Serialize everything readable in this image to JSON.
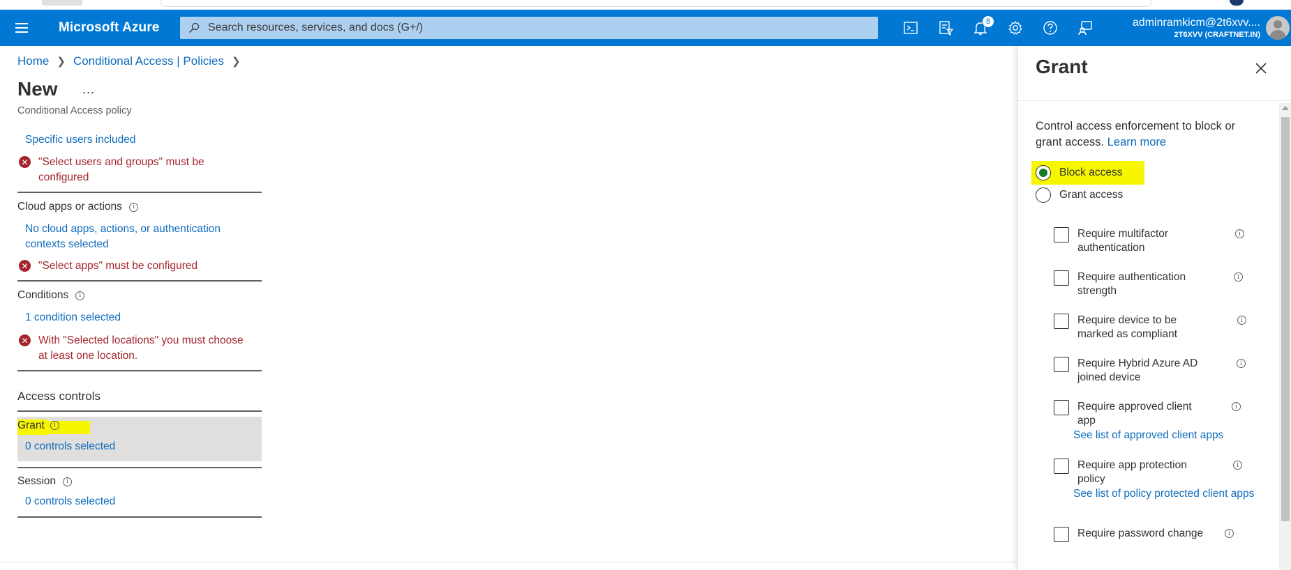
{
  "header": {
    "brand": "Microsoft Azure",
    "search_placeholder": "Search resources, services, and docs (G+/)",
    "notification_count": "8",
    "account_name": "adminramkicm@2t6xvv....",
    "account_tenant": "2T6XVV (CRAFTNET.IN)",
    "icons": [
      "cloud-shell-icon",
      "directory-filter-icon",
      "notifications-icon",
      "settings-icon",
      "help-icon",
      "feedback-icon"
    ]
  },
  "breadcrumb": {
    "home": "Home",
    "policies": "Conditional Access | Policies"
  },
  "page": {
    "title": "New",
    "more": "...",
    "subtitle": "Conditional Access policy"
  },
  "left": {
    "users_link": "Specific users included",
    "users_error": "\"Select users and groups\" must be configured",
    "cloud_apps_label": "Cloud apps or actions",
    "cloud_apps_link": "No cloud apps, actions, or authentication contexts selected",
    "cloud_apps_error": "\"Select apps\" must be configured",
    "conditions_label": "Conditions",
    "conditions_link": "1 condition selected",
    "conditions_error": "With \"Selected locations\" you must choose at least one location.",
    "access_controls_label": "Access controls",
    "grant_label": "Grant",
    "grant_link": "0 controls selected",
    "session_label": "Session",
    "session_link": "0 controls selected"
  },
  "panel": {
    "title": "Grant",
    "description": "Control access enforcement to block or grant access.",
    "learn_more": "Learn more",
    "block_access": "Block access",
    "grant_access": "Grant access",
    "selected_option": "Block access",
    "options": [
      {
        "label": "Require multifactor authentication",
        "checked": false
      },
      {
        "label": "Require authentication strength",
        "checked": false
      },
      {
        "label": "Require device to be marked as compliant",
        "checked": false
      },
      {
        "label": "Require Hybrid Azure AD joined device",
        "checked": false
      },
      {
        "label": "Require approved client app",
        "checked": false,
        "link": "See list of approved client apps"
      },
      {
        "label": "Require app protection policy",
        "checked": false,
        "link": "See list of policy protected client apps"
      },
      {
        "label": "Require password change",
        "checked": false
      }
    ]
  },
  "colors": {
    "accent": "#0078d4",
    "link": "#0f6cbd",
    "error": "#a4262c",
    "highlight": "#f6f600",
    "selected_radio": "#1b7a24"
  }
}
